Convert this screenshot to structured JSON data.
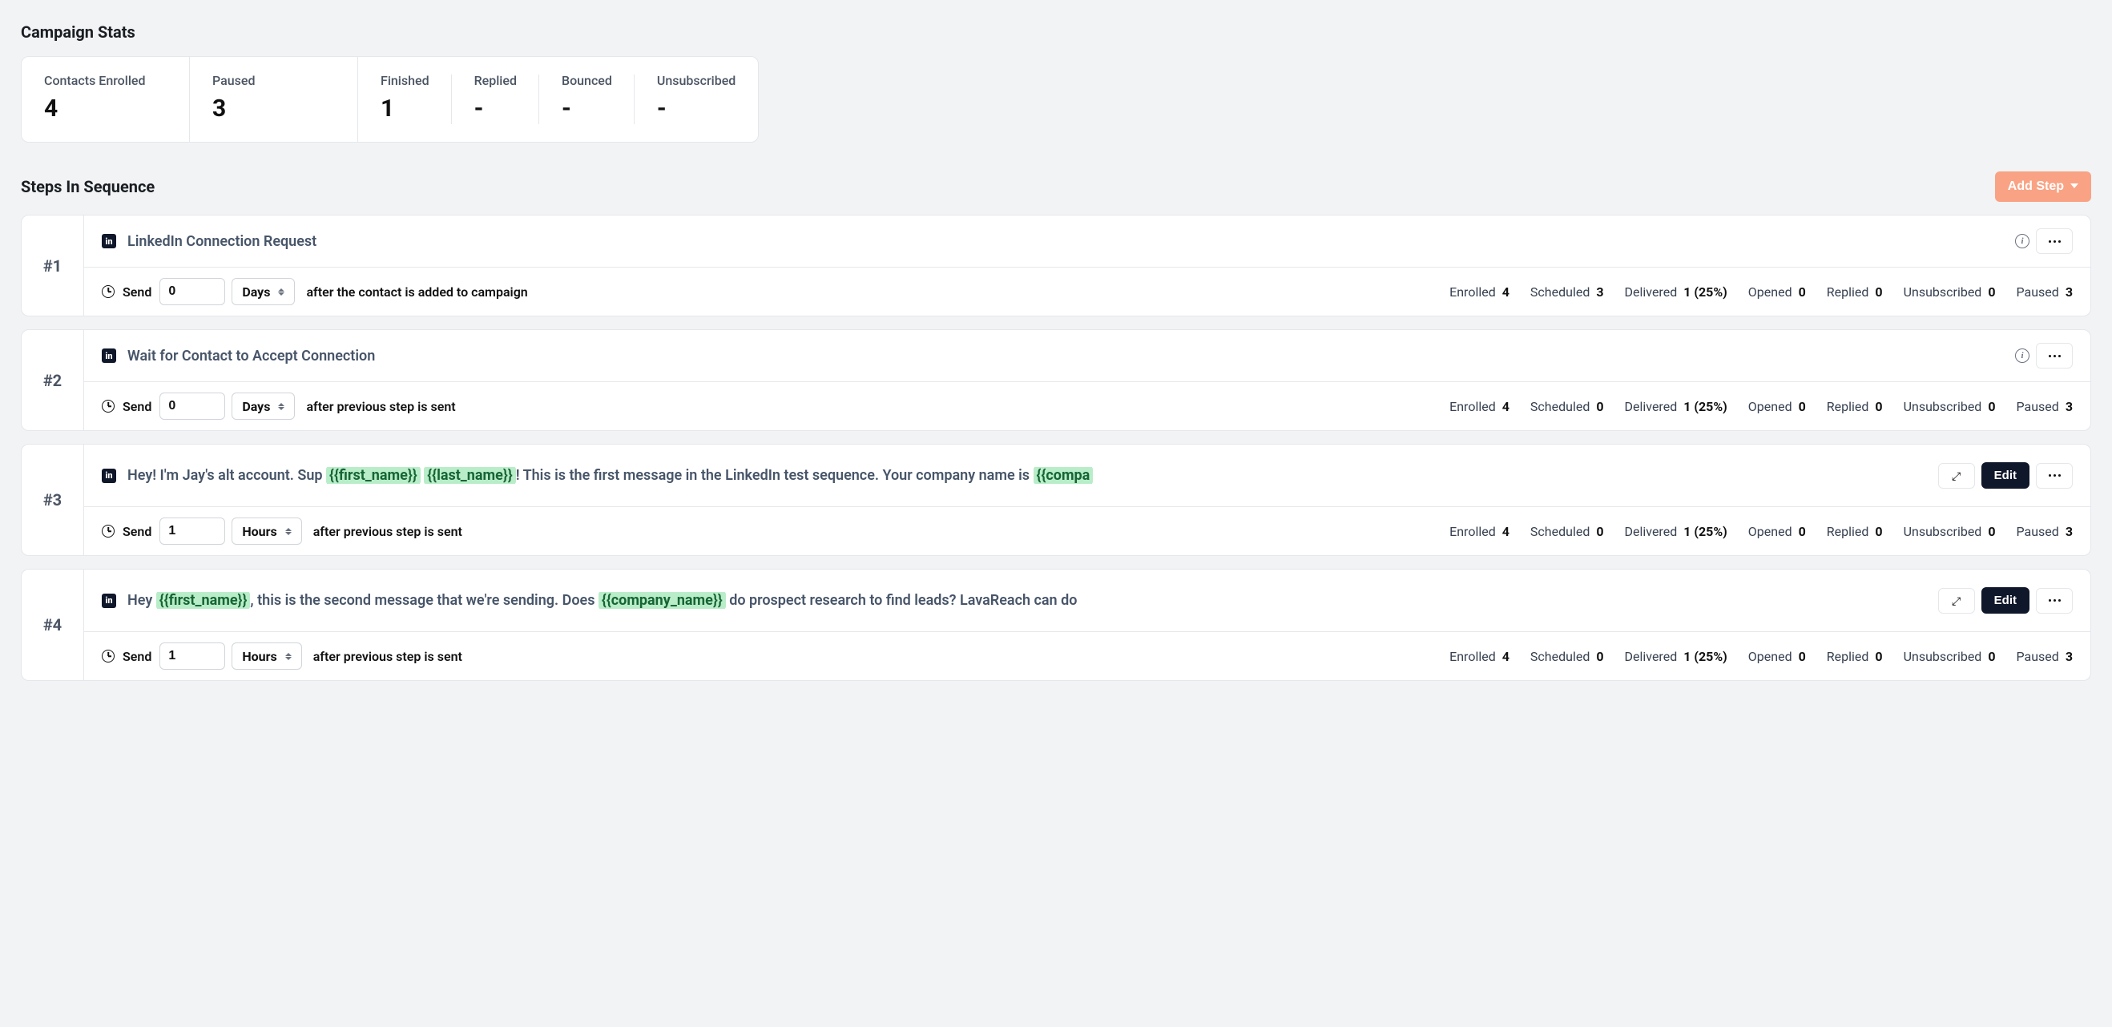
{
  "titles": {
    "campaign_stats": "Campaign Stats",
    "steps_in_sequence": "Steps In Sequence"
  },
  "stats": {
    "contacts_enrolled": {
      "label": "Contacts Enrolled",
      "value": "4"
    },
    "paused": {
      "label": "Paused",
      "value": "3"
    },
    "finished": {
      "label": "Finished",
      "value": "1"
    },
    "replied": {
      "label": "Replied",
      "value": "-"
    },
    "bounced": {
      "label": "Bounced",
      "value": "-"
    },
    "unsubscribed": {
      "label": "Unsubscribed",
      "value": "-"
    }
  },
  "add_step_label": "Add Step",
  "linkedin_glyph": "in",
  "edit_label": "Edit",
  "send_label": "Send",
  "metric_labels": {
    "enrolled": "Enrolled",
    "scheduled": "Scheduled",
    "delivered": "Delivered",
    "opened": "Opened",
    "replied": "Replied",
    "unsubscribed": "Unsubscribed",
    "paused": "Paused"
  },
  "steps": [
    {
      "num": "#1",
      "title": "LinkedIn Connection Request",
      "has_message": false,
      "send": {
        "value": "0",
        "unit": "Days",
        "after_text": "after the contact is added to campaign"
      },
      "metrics": {
        "enrolled": "4",
        "scheduled": "3",
        "delivered": "1 (25%)",
        "opened": "0",
        "replied": "0",
        "unsubscribed": "0",
        "paused": "3"
      }
    },
    {
      "num": "#2",
      "title": "Wait for Contact to Accept Connection",
      "has_message": false,
      "send": {
        "value": "0",
        "unit": "Days",
        "after_text": "after previous step is sent"
      },
      "metrics": {
        "enrolled": "4",
        "scheduled": "0",
        "delivered": "1 (25%)",
        "opened": "0",
        "replied": "0",
        "unsubscribed": "0",
        "paused": "3"
      }
    },
    {
      "num": "#3",
      "has_message": true,
      "message": {
        "pre1": "Hey! I'm Jay's alt account. Sup ",
        "tok1": "{{first_name}}",
        "mid1": " ",
        "tok2": "{{last_name}}",
        "mid2": "! This is the first message in the LinkedIn test sequence. Your company name is ",
        "tok3": "{{compa"
      },
      "send": {
        "value": "1",
        "unit": "Hours",
        "after_text": "after previous step is sent"
      },
      "metrics": {
        "enrolled": "4",
        "scheduled": "0",
        "delivered": "1 (25%)",
        "opened": "0",
        "replied": "0",
        "unsubscribed": "0",
        "paused": "3"
      }
    },
    {
      "num": "#4",
      "has_message": true,
      "message": {
        "pre1": "Hey ",
        "tok1": "{{first_name}}",
        "mid1": ", this is the second message that we're sending. Does ",
        "tok2": "{{company_name}}",
        "mid2": " do prospect research to find leads? LavaReach can do",
        "tok3": ""
      },
      "send": {
        "value": "1",
        "unit": "Hours",
        "after_text": "after previous step is sent"
      },
      "metrics": {
        "enrolled": "4",
        "scheduled": "0",
        "delivered": "1 (25%)",
        "opened": "0",
        "replied": "0",
        "unsubscribed": "0",
        "paused": "3"
      }
    }
  ]
}
